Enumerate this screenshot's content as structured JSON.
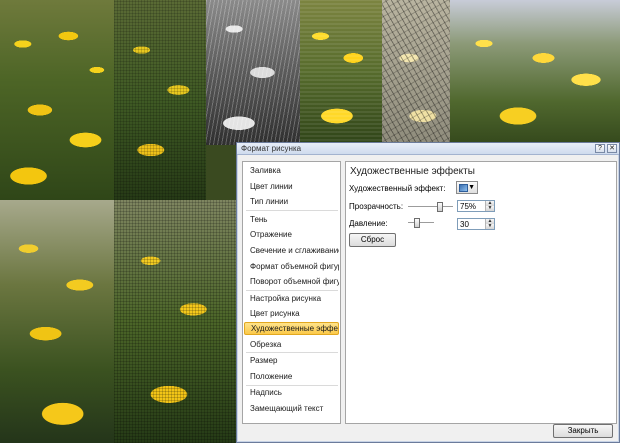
{
  "dialog": {
    "title": "Формат рисунка",
    "help_button": "?",
    "close_x": "✕",
    "close_button_label": "Закрыть"
  },
  "nav": {
    "items": [
      {
        "label": "Заливка"
      },
      {
        "label": "Цвет линии"
      },
      {
        "label": "Тип линии"
      },
      {
        "label": "Тень"
      },
      {
        "label": "Отражение"
      },
      {
        "label": "Свечение и сглаживание"
      },
      {
        "label": "Формат объемной фигуры"
      },
      {
        "label": "Поворот объемной фигуры"
      },
      {
        "label": "Настройка рисунка"
      },
      {
        "label": "Цвет рисунка"
      },
      {
        "label": "Художественные эффекты",
        "selected": true
      },
      {
        "label": "Обрезка"
      },
      {
        "label": "Размер"
      },
      {
        "label": "Положение"
      },
      {
        "label": "Надпись"
      },
      {
        "label": "Замещающий текст"
      }
    ]
  },
  "panel": {
    "title": "Художественные эффекты",
    "effect_label": "Художественный эффект:",
    "transparency_label": "Прозрачность:",
    "transparency_value": "75%",
    "transparency_level": 0.75,
    "pressure_label": "Давление:",
    "pressure_value": "30",
    "pressure_level": 0.3,
    "reset_label": "Сброс"
  }
}
